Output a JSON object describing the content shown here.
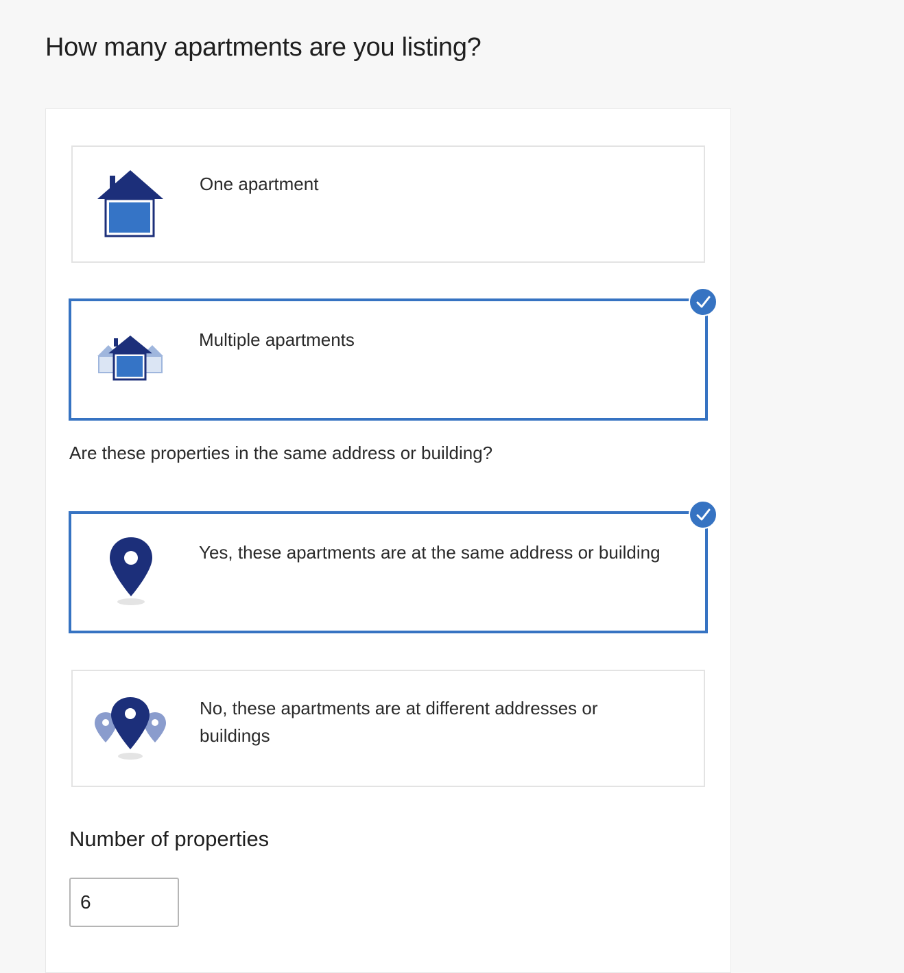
{
  "page": {
    "title": "How many apartments are you listing?"
  },
  "apartment_count": {
    "options": [
      {
        "label": "One apartment",
        "icon": "single-house-icon",
        "selected": false
      },
      {
        "label": "Multiple apartments",
        "icon": "multiple-houses-icon",
        "selected": true
      }
    ]
  },
  "same_address": {
    "question": "Are these properties in the same address or building?",
    "options": [
      {
        "label": "Yes, these apartments are at the same address or building",
        "icon": "location-pin-icon",
        "selected": true
      },
      {
        "label": "No, these apartments are at different addresses or buildings",
        "icon": "multiple-location-pins-icon",
        "selected": false
      }
    ]
  },
  "number_of_properties": {
    "label": "Number of properties",
    "value": "6"
  },
  "colors": {
    "accent": "#3673c2",
    "icon_dark": "#1c2f7a",
    "icon_fill": "#3574c6",
    "icon_light": "#9fb6dd"
  }
}
